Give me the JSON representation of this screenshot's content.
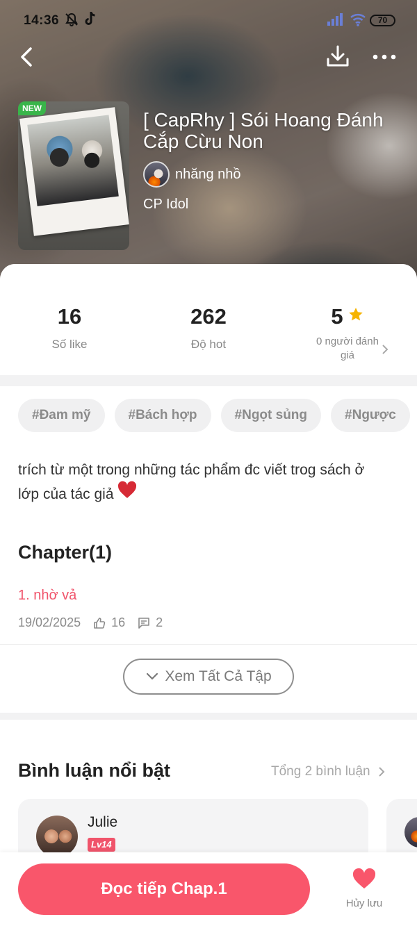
{
  "status_bar": {
    "time": "14:36",
    "battery": "70"
  },
  "story": {
    "title": "[ CapRhy ] Sói Hoang Đánh Cắp Cừu Non",
    "badge": "NEW",
    "author": "nhăng nhồ",
    "category": "CP Idol"
  },
  "stats": {
    "likes": {
      "value": "16",
      "label": "Số like"
    },
    "hot": {
      "value": "262",
      "label": "Độ hot"
    },
    "rating": {
      "value": "5",
      "label": "0 người đánh giá"
    }
  },
  "tags": [
    "#Đam mỹ",
    "#Bách hợp",
    "#Ngọt sủng",
    "#Ngược"
  ],
  "description": "trích từ một trong những tác phẩm đc viết trog sách ở lớp của tác giả",
  "chapters": {
    "heading": "Chapter(1)",
    "items": [
      {
        "title": "1. nhờ vả",
        "date": "19/02/2025",
        "likes": "16",
        "comments": "2"
      }
    ],
    "view_all_label": "Xem Tất Cả Tập"
  },
  "comments": {
    "heading": "Bình luận nổi bật",
    "total": "Tổng 2 bình luận",
    "items": [
      {
        "name": "Julie",
        "level": "Lv14"
      }
    ]
  },
  "bottom_bar": {
    "read_label": "Đọc tiếp Chap.1",
    "unsave_label": "Hủy lưu"
  },
  "colors": {
    "accent": "#f9566b",
    "link": "#f0546b",
    "badge_new": "#39b54a",
    "star": "#f6b400"
  },
  "icons": [
    "back-arrow-icon",
    "download-icon",
    "more-icon",
    "star-icon",
    "heart-icon",
    "thumbs-up-icon",
    "comment-icon",
    "chevron-down-icon",
    "chevron-right-icon"
  ]
}
